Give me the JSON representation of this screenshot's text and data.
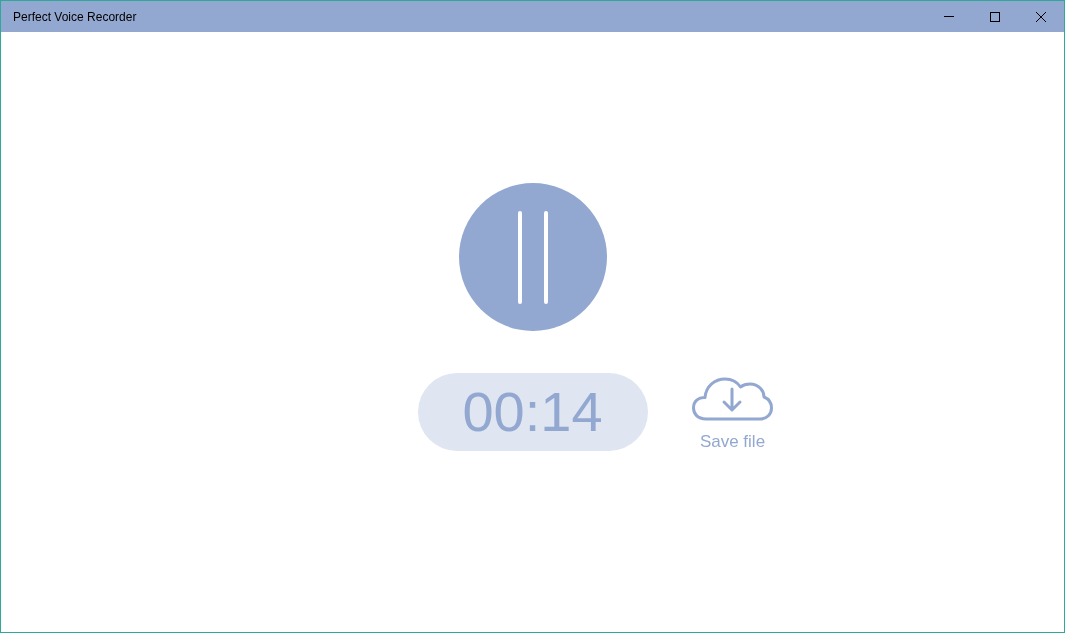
{
  "window": {
    "title": "Perfect Voice Recorder"
  },
  "record_button": {
    "recording": true
  },
  "timer": "00:14",
  "save": {
    "label": "Save file"
  }
}
